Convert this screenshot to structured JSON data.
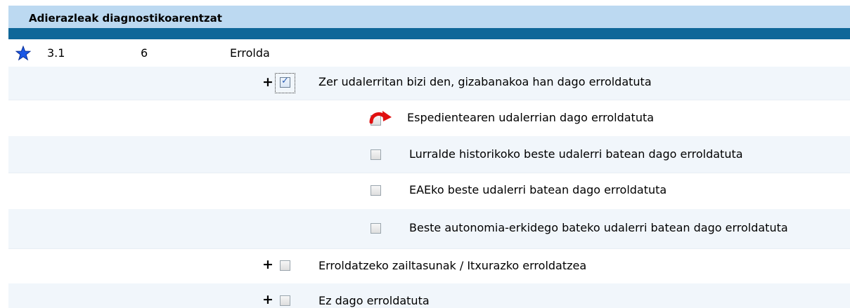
{
  "header": {
    "title": "Adierazleak diagnostikoarentzat"
  },
  "section": {
    "code": "3.1",
    "count": "6",
    "name": "Errolda"
  },
  "questions": [
    {
      "label": "Zer udalerritan bizi den, gizabanakoa han dago erroldatuta",
      "checked": true,
      "expand": "+"
    },
    {
      "label": "Erroldatzeko zailtasunak / Itxurazko erroldatzea",
      "checked": false,
      "expand": "+"
    },
    {
      "label": "Ez dago erroldatuta",
      "checked": false,
      "expand": "+"
    }
  ],
  "options": [
    {
      "label": "Espedientearen udalerrian dago erroldatuta",
      "checked": false
    },
    {
      "label": "Lurralde historikoko beste udalerri batean dago erroldatuta",
      "checked": false
    },
    {
      "label": "EAEko beste udalerri batean dago erroldatuta",
      "checked": false
    },
    {
      "label": "Beste autonomia-erkidego bateko udalerri batean dago erroldatuta",
      "checked": false
    }
  ],
  "colors": {
    "header_bg": "#bcd9f1",
    "header_bar": "#0f6799",
    "star": "#1a57e6",
    "refresh_arrow": "#e01010"
  },
  "icons": {
    "favorite": "star-icon",
    "refresh": "refresh-arrow-icon",
    "expand": "plus-icon",
    "check": "checkmark-icon"
  }
}
